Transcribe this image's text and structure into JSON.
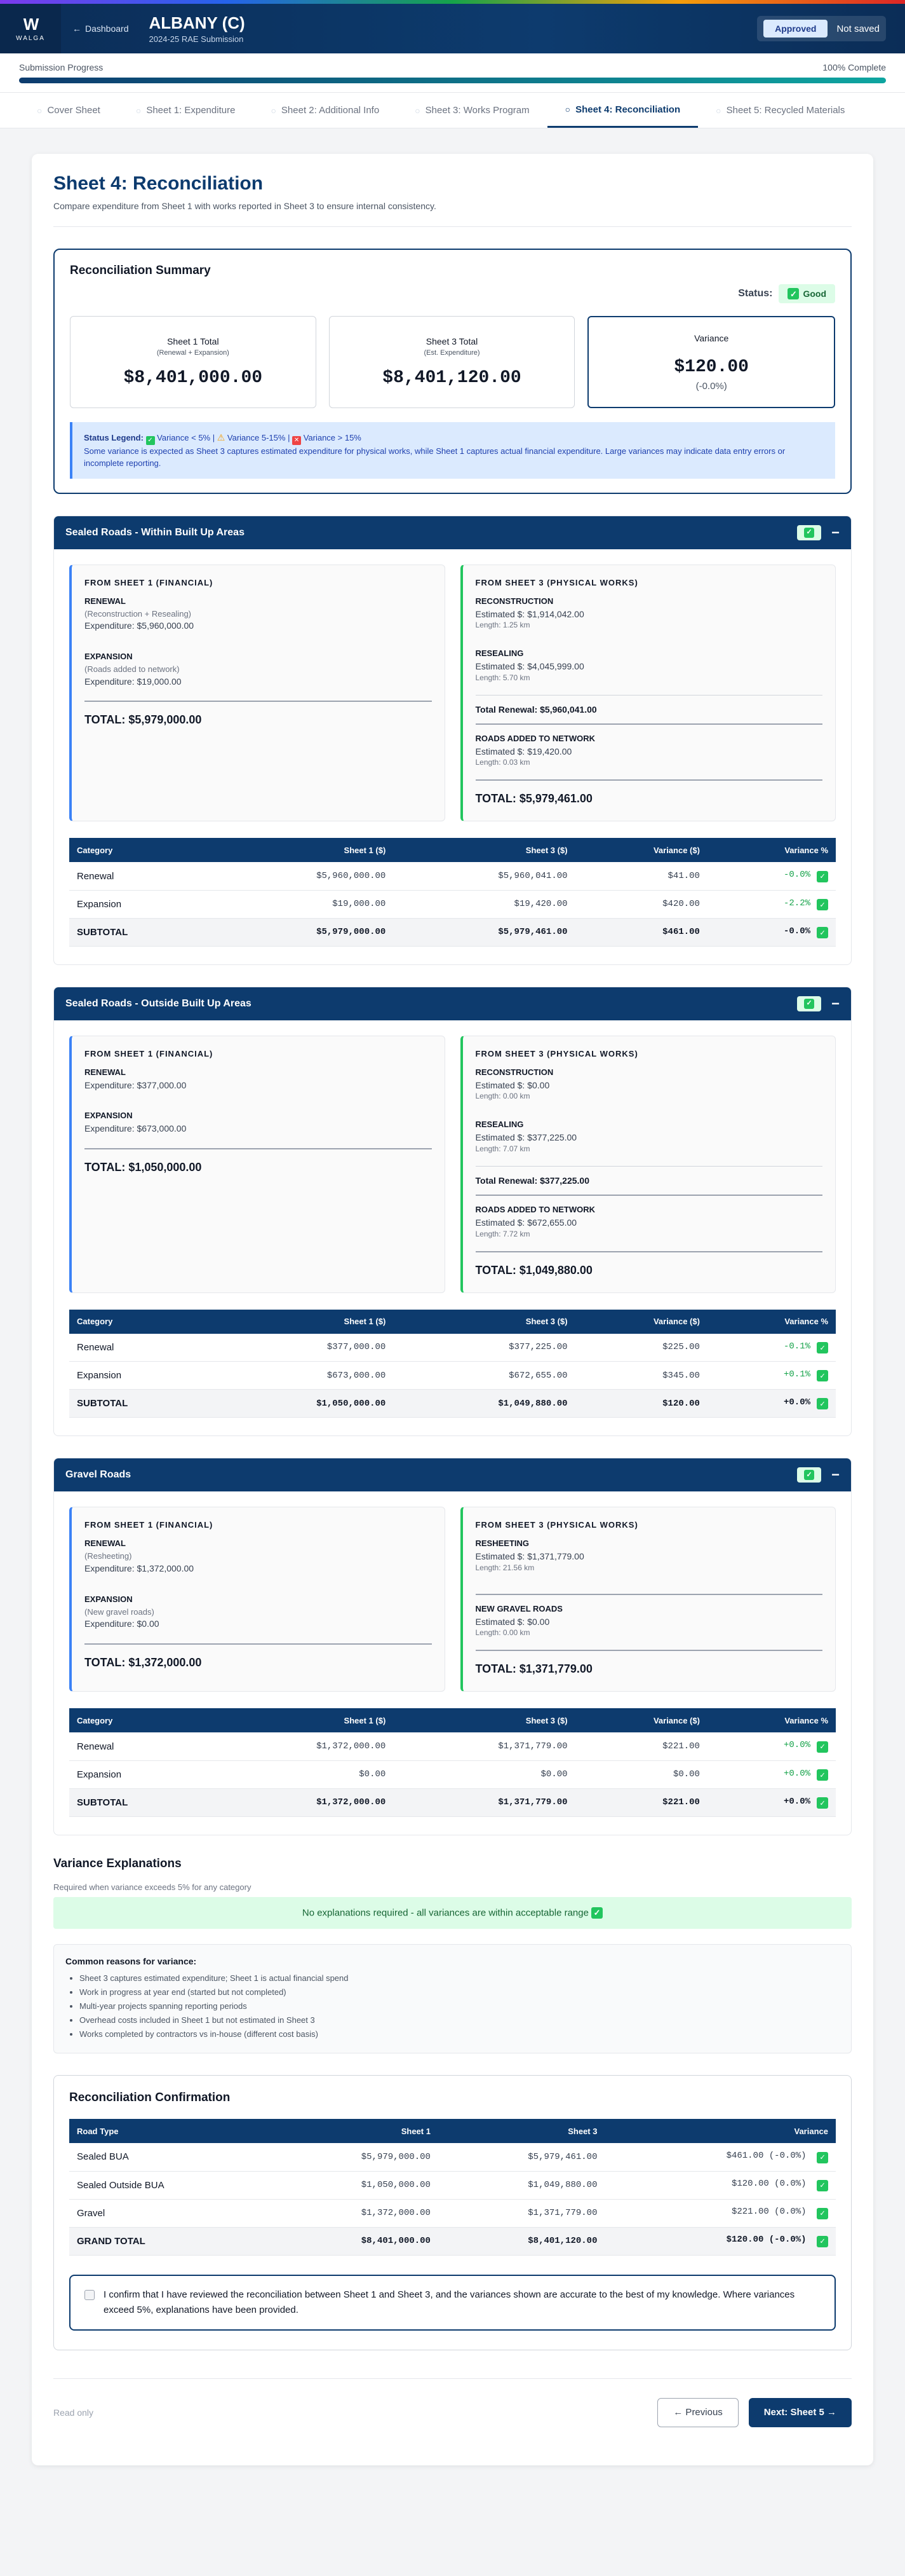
{
  "header": {
    "logo_mark": "W",
    "logo_text": "WALGA",
    "back": "Dashboard",
    "back_icon": "←",
    "title": "ALBANY (C)",
    "subtitle": "2024-25 RAE Submission",
    "status_badge": "Approved",
    "save_state": "Not saved"
  },
  "progress": {
    "label": "Submission Progress",
    "value_text": "100% Complete",
    "value": 1.0
  },
  "tabs": [
    {
      "label": "Cover Sheet"
    },
    {
      "label": "Sheet 1: Expenditure"
    },
    {
      "label": "Sheet 2: Additional Info"
    },
    {
      "label": "Sheet 3: Works Program"
    },
    {
      "label": "Sheet 4: Reconciliation"
    },
    {
      "label": "Sheet 5: Recycled Materials"
    }
  ],
  "page": {
    "title": "Sheet 4: Reconciliation",
    "description": "Compare expenditure from Sheet 1 with works reported in Sheet 3 to ensure internal consistency."
  },
  "summary": {
    "title": "Reconciliation Summary",
    "status_label": "Status:",
    "status_value": "Good",
    "sheet1": {
      "label": "Sheet 1 Total",
      "sub": "(Renewal + Expansion)",
      "value": "$8,401,000.00"
    },
    "sheet3": {
      "label": "Sheet 3 Total",
      "sub": "(Est. Expenditure)",
      "value": "$8,401,120.00"
    },
    "variance": {
      "label": "Variance",
      "value": "$120.00",
      "pct": "(-0.0%)"
    },
    "legend": {
      "title": "Status Legend:",
      "good": "Variance < 5%",
      "warn": "Variance 5-15%",
      "bad": "Variance > 15%",
      "text": "Some variance is expected as Sheet 3 captures estimated expenditure for physical works, while Sheet 1 captures actual financial expenditure. Large variances may indicate data entry errors or incomplete reporting."
    }
  },
  "labels": {
    "from1": "FROM SHEET 1 (FINANCIAL)",
    "from3": "FROM SHEET 3 (PHYSICAL WORKS)",
    "col_category": "Category",
    "col_s1": "Sheet 1 ($)",
    "col_s3": "Sheet 3 ($)",
    "col_var": "Variance ($)",
    "col_varpct": "Variance %"
  },
  "sections": [
    {
      "title": "Sealed Roads - Within Built Up Areas",
      "s1": {
        "renewal_t": "RENEWAL",
        "renewal_n": "(Reconstruction + Resealing)",
        "renewal_v": "Expenditure: $5,960,000.00",
        "exp_t": "EXPANSION",
        "exp_n": "(Roads added to network)",
        "exp_v": "Expenditure: $19,000.00",
        "total": "TOTAL: $5,979,000.00"
      },
      "s3": {
        "a_t": "RECONSTRUCTION",
        "a_v": "Estimated $: $1,914,042.00",
        "a_l": "Length: 1.25 km",
        "b_t": "RESEALING",
        "b_v": "Estimated $: $4,045,999.00",
        "b_l": "Length: 5.70 km",
        "ren": "Total Renewal: $5,960,041.00",
        "c_t": "ROADS ADDED TO NETWORK",
        "c_v": "Estimated $: $19,420.00",
        "c_l": "Length: 0.03 km",
        "total": "TOTAL: $5,979,461.00"
      },
      "rows": [
        [
          "Renewal",
          "$5,960,000.00",
          "$5,960,041.00",
          "$41.00",
          "-0.0%"
        ],
        [
          "Expansion",
          "$19,000.00",
          "$19,420.00",
          "$420.00",
          "-2.2%"
        ],
        [
          "SUBTOTAL",
          "$5,979,000.00",
          "$5,979,461.00",
          "$461.00",
          "-0.0%"
        ]
      ]
    },
    {
      "title": "Sealed Roads - Outside Built Up Areas",
      "s1": {
        "renewal_t": "RENEWAL",
        "renewal_n": "",
        "renewal_v": "Expenditure: $377,000.00",
        "exp_t": "EXPANSION",
        "exp_n": "",
        "exp_v": "Expenditure: $673,000.00",
        "total": "TOTAL: $1,050,000.00"
      },
      "s3": {
        "a_t": "RECONSTRUCTION",
        "a_v": "Estimated $: $0.00",
        "a_l": "Length: 0.00 km",
        "b_t": "RESEALING",
        "b_v": "Estimated $: $377,225.00",
        "b_l": "Length: 7.07 km",
        "ren": "Total Renewal: $377,225.00",
        "c_t": "ROADS ADDED TO NETWORK",
        "c_v": "Estimated $: $672,655.00",
        "c_l": "Length: 7.72 km",
        "total": "TOTAL: $1,049,880.00"
      },
      "rows": [
        [
          "Renewal",
          "$377,000.00",
          "$377,225.00",
          "$225.00",
          "-0.1%"
        ],
        [
          "Expansion",
          "$673,000.00",
          "$672,655.00",
          "$345.00",
          "+0.1%"
        ],
        [
          "SUBTOTAL",
          "$1,050,000.00",
          "$1,049,880.00",
          "$120.00",
          "+0.0%"
        ]
      ]
    },
    {
      "title": "Gravel Roads",
      "s1": {
        "renewal_t": "RENEWAL",
        "renewal_n": "(Resheeting)",
        "renewal_v": "Expenditure: $1,372,000.00",
        "exp_t": "EXPANSION",
        "exp_n": "(New gravel roads)",
        "exp_v": "Expenditure: $0.00",
        "total": "TOTAL: $1,372,000.00"
      },
      "s3": {
        "a_t": "RESHEETING",
        "a_v": "Estimated $: $1,371,779.00",
        "a_l": "Length: 21.56 km",
        "c_t": "NEW GRAVEL ROADS",
        "c_v": "Estimated $: $0.00",
        "c_l": "Length: 0.00 km",
        "total": "TOTAL: $1,371,779.00"
      },
      "rows": [
        [
          "Renewal",
          "$1,372,000.00",
          "$1,371,779.00",
          "$221.00",
          "+0.0%"
        ],
        [
          "Expansion",
          "$0.00",
          "$0.00",
          "$0.00",
          "+0.0%"
        ],
        [
          "SUBTOTAL",
          "$1,372,000.00",
          "$1,371,779.00",
          "$221.00",
          "+0.0%"
        ]
      ]
    }
  ],
  "variance_explanations": {
    "title": "Variance Explanations",
    "required": "Required when variance exceeds 5% for any category",
    "none_needed": "No explanations required - all variances are within acceptable range",
    "reasons_title": "Common reasons for variance:",
    "reasons": [
      "Sheet 3 captures estimated expenditure; Sheet 1 is actual financial spend",
      "Work in progress at year end (started but not completed)",
      "Multi-year projects spanning reporting periods",
      "Overhead costs included in Sheet 1 but not estimated in Sheet 3",
      "Works completed by contractors vs in-house (different cost basis)"
    ]
  },
  "confirmation": {
    "title": "Reconciliation Confirmation",
    "col_type": "Road Type",
    "col_s1": "Sheet 1",
    "col_s3": "Sheet 3",
    "col_var": "Variance",
    "rows": [
      [
        "Sealed BUA",
        "$5,979,000.00",
        "$5,979,461.00",
        "$461.00 (-0.0%)"
      ],
      [
        "Sealed Outside BUA",
        "$1,050,000.00",
        "$1,049,880.00",
        "$120.00 (0.0%)"
      ],
      [
        "Gravel",
        "$1,372,000.00",
        "$1,371,779.00",
        "$221.00 (0.0%)"
      ],
      [
        "GRAND TOTAL",
        "$8,401,000.00",
        "$8,401,120.00",
        "$120.00 (-0.0%)"
      ]
    ],
    "statement": "I confirm that I have reviewed the reconciliation between Sheet 1 and Sheet 3, and the variances shown are accurate to the best of my knowledge. Where variances exceed 5%, explanations have been provided."
  },
  "footer": {
    "readonly": "Read only",
    "prev": "← Previous",
    "next": "Next: Sheet 5 →"
  },
  "colors": {
    "primary": "#0d3b6e",
    "good": "#22c55e",
    "info": "#3b82f6"
  }
}
